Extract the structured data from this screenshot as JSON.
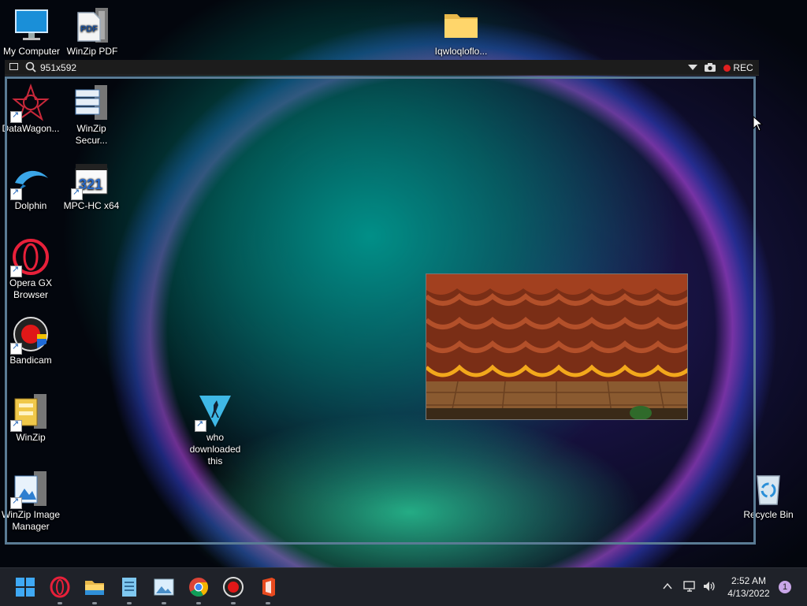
{
  "desktop": {
    "icons": [
      {
        "label": "My Computer"
      },
      {
        "label": "WinZip PDF"
      },
      {
        "label": "Iqwloqloflo..."
      },
      {
        "label": "DataWagon..."
      },
      {
        "label": "WinZip Secur..."
      },
      {
        "label": "Dolphin"
      },
      {
        "label": "MPC-HC x64"
      },
      {
        "label": "Opera GX Browser"
      },
      {
        "label": "Bandicam"
      },
      {
        "label": "WinZip"
      },
      {
        "label": "WinZip Image Manager"
      },
      {
        "label": "who downloaded this"
      },
      {
        "label": "Recycle Bin"
      }
    ],
    "pdf_badge": "PDF",
    "mpc_badge": "321"
  },
  "recorder": {
    "size_readout": "951x592",
    "rec_label": "REC",
    "rec_color": "#e02020",
    "frame_color": "#5a7b94"
  },
  "taskbar": {
    "apps": [
      "start-icon",
      "opera-gx-icon",
      "file-explorer-icon",
      "notepad-icon",
      "photos-icon",
      "chrome-icon",
      "bandicam-icon",
      "office-icon"
    ],
    "time": "2:52 AM",
    "date": "4/13/2022",
    "notification_count": "1"
  }
}
